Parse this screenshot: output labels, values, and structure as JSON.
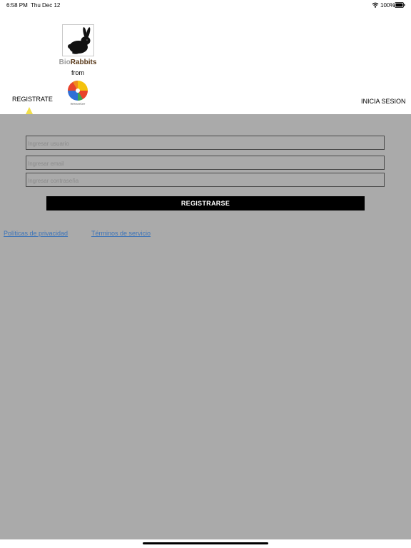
{
  "status_bar": {
    "time": "6:58 PM",
    "date": "Thu Dec 12",
    "battery": "100%",
    "icons": [
      "wifi-icon",
      "battery-icon"
    ]
  },
  "header": {
    "brand_part1": "Bio",
    "brand_part2": "Rabbits",
    "from_label": "from",
    "partner_logo_text": "BioNaturalCare",
    "tabs": {
      "register": "REGISTRATE",
      "login": "INICIA SESION"
    },
    "active_tab_color": "#f2df4a"
  },
  "form": {
    "user_placeholder": "Ingresar usuario",
    "email_placeholder": "Ingresar email",
    "password_placeholder": "Ingresar contraseña",
    "submit_label": "REGISTRARSE",
    "background_color": "#aaaaaa",
    "button_color": "#000000",
    "link_color": "#3d74b8"
  },
  "links": {
    "privacy": "Políticas de privacidad",
    "terms": "Términos de servicio"
  }
}
